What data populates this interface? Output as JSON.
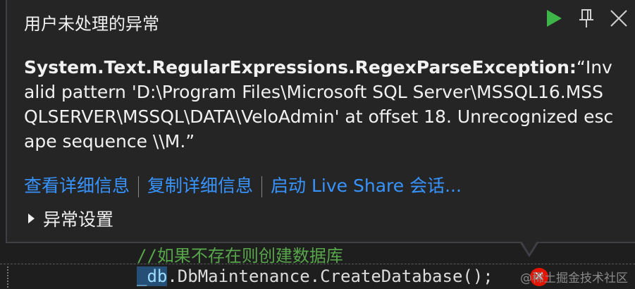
{
  "background_code": {
    "top_line": "……… ……… …… ……… ………",
    "comment": "//如果不存在则创建数据库",
    "code_prefix": "_db",
    "code_rest": ".DbMaintenance.CreateDatabase();",
    "code_tail": " "
  },
  "popup": {
    "title": "用户未处理的异常",
    "exception_type": "System.Text.RegularExpressions.RegexParseException:",
    "exception_message": "“Invalid pattern 'D:\\Program Files\\Microsoft SQL Server\\MSSQL16.MSSQLSERVER\\MSSQL\\DATA\\VeloAdmin' at offset 18. Unrecognized escape sequence \\\\M.”",
    "links": {
      "view_details": "查看详细信息",
      "copy_details": "复制详细信息",
      "live_share": "启动 Live Share 会话..."
    },
    "settings_label": "异常设置",
    "icons": {
      "continue": "play-icon",
      "pin": "pin-icon",
      "close": "close-icon"
    }
  },
  "watermark": "@稀土掘金技术社区",
  "colors": {
    "popup_bg": "#252526",
    "link": "#3794ff",
    "continue_green": "#3eb549",
    "comment_green": "#57a64a",
    "error_red": "#e51400"
  }
}
